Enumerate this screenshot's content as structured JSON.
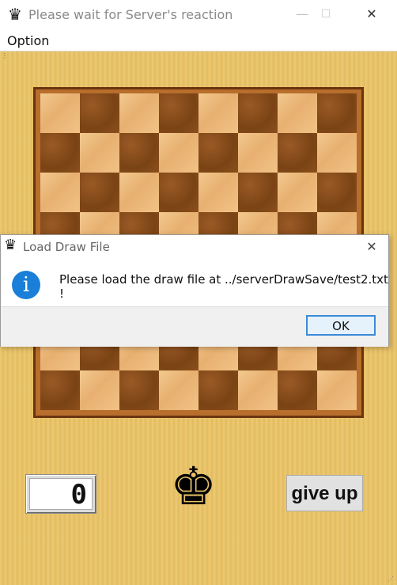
{
  "window": {
    "title": "Please wait for Server's reaction",
    "app_icon": "chess-queen-icon",
    "minimize_label": "—",
    "maximize_label": "☐",
    "close_label": "✕"
  },
  "menu": {
    "option_label": "Option"
  },
  "board": {
    "rows": 8,
    "cols": 8,
    "light_color": "#ecbc7c",
    "dark_color": "#82491b"
  },
  "game": {
    "counter_value": "0",
    "turn_piece": "chess-king-icon",
    "turn_glyph": "♚",
    "give_up_label": "give up"
  },
  "dialog": {
    "title": "Load Draw File",
    "message": "Please load the draw file at ../serverDrawSave/test2.txt !",
    "icon": "info-icon",
    "icon_glyph": "i",
    "ok_label": "OK",
    "close_label": "✕"
  },
  "colors": {
    "background": "#e9c265",
    "frame": "#b86e2c",
    "info_blue": "#1a7fd8",
    "ok_border": "#3c8ad8"
  }
}
